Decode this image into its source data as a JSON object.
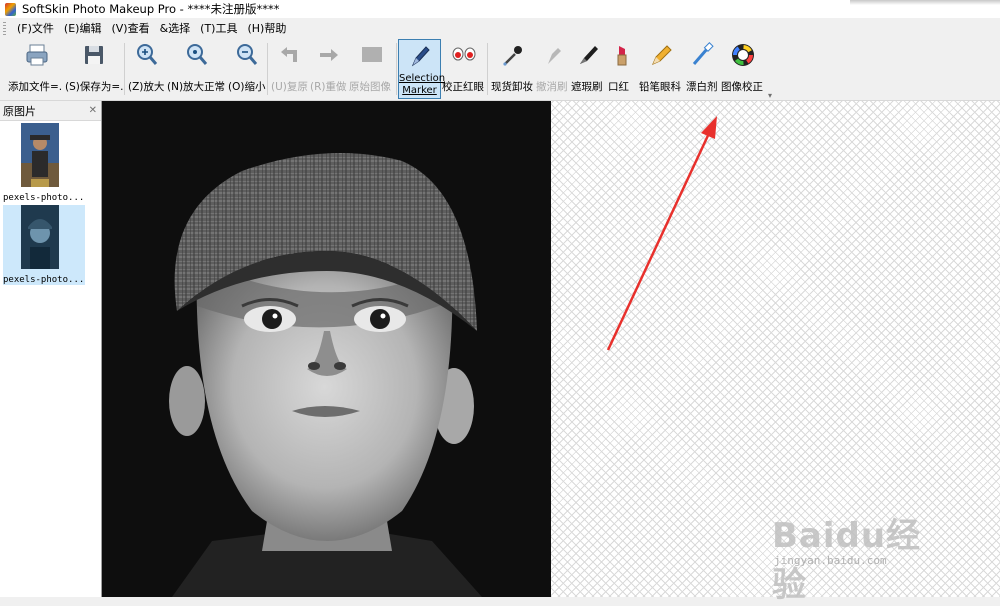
{
  "window": {
    "title": "SoftSkin Photo Makeup Pro - ****未注册版****"
  },
  "menu": [
    {
      "label": "(F)文件"
    },
    {
      "label": "(E)编辑"
    },
    {
      "label": "(V)查看"
    },
    {
      "label": "&选择"
    },
    {
      "label": "(T)工具"
    },
    {
      "label": "(H)帮助"
    }
  ],
  "toolbar": {
    "add_file": "添加文件=.",
    "save_as": "(S)保存为=.",
    "zoom_in": "(Z)放大",
    "zoom_normal": "(N)放大正常",
    "zoom_out": "(O)缩小",
    "undo": "(U)复原",
    "redo": "(R)重做",
    "original": "原始图像",
    "selection_marker_line1": "Selection",
    "selection_marker_line2": "Marker",
    "red_eye": "校正红眼",
    "remove_makeup": "现货卸妆",
    "undo_brush": "撤消刷",
    "concealer": "遮瑕刷",
    "lipstick": "口红",
    "eyeliner": "铅笔眼科",
    "whitener": "漂白剂",
    "color_correct": "图像校正"
  },
  "panel": {
    "title": "原图片",
    "thumbs": [
      {
        "caption": "pexels-photo..."
      },
      {
        "caption": "pexels-photo..."
      }
    ]
  },
  "watermark": {
    "text": "Baidu经验",
    "sub": "jingyan.baidu.com"
  },
  "colors": {
    "accent": "#3c7fb1",
    "selection_bg": "#cce4f7",
    "arrow": "#e8302c"
  }
}
